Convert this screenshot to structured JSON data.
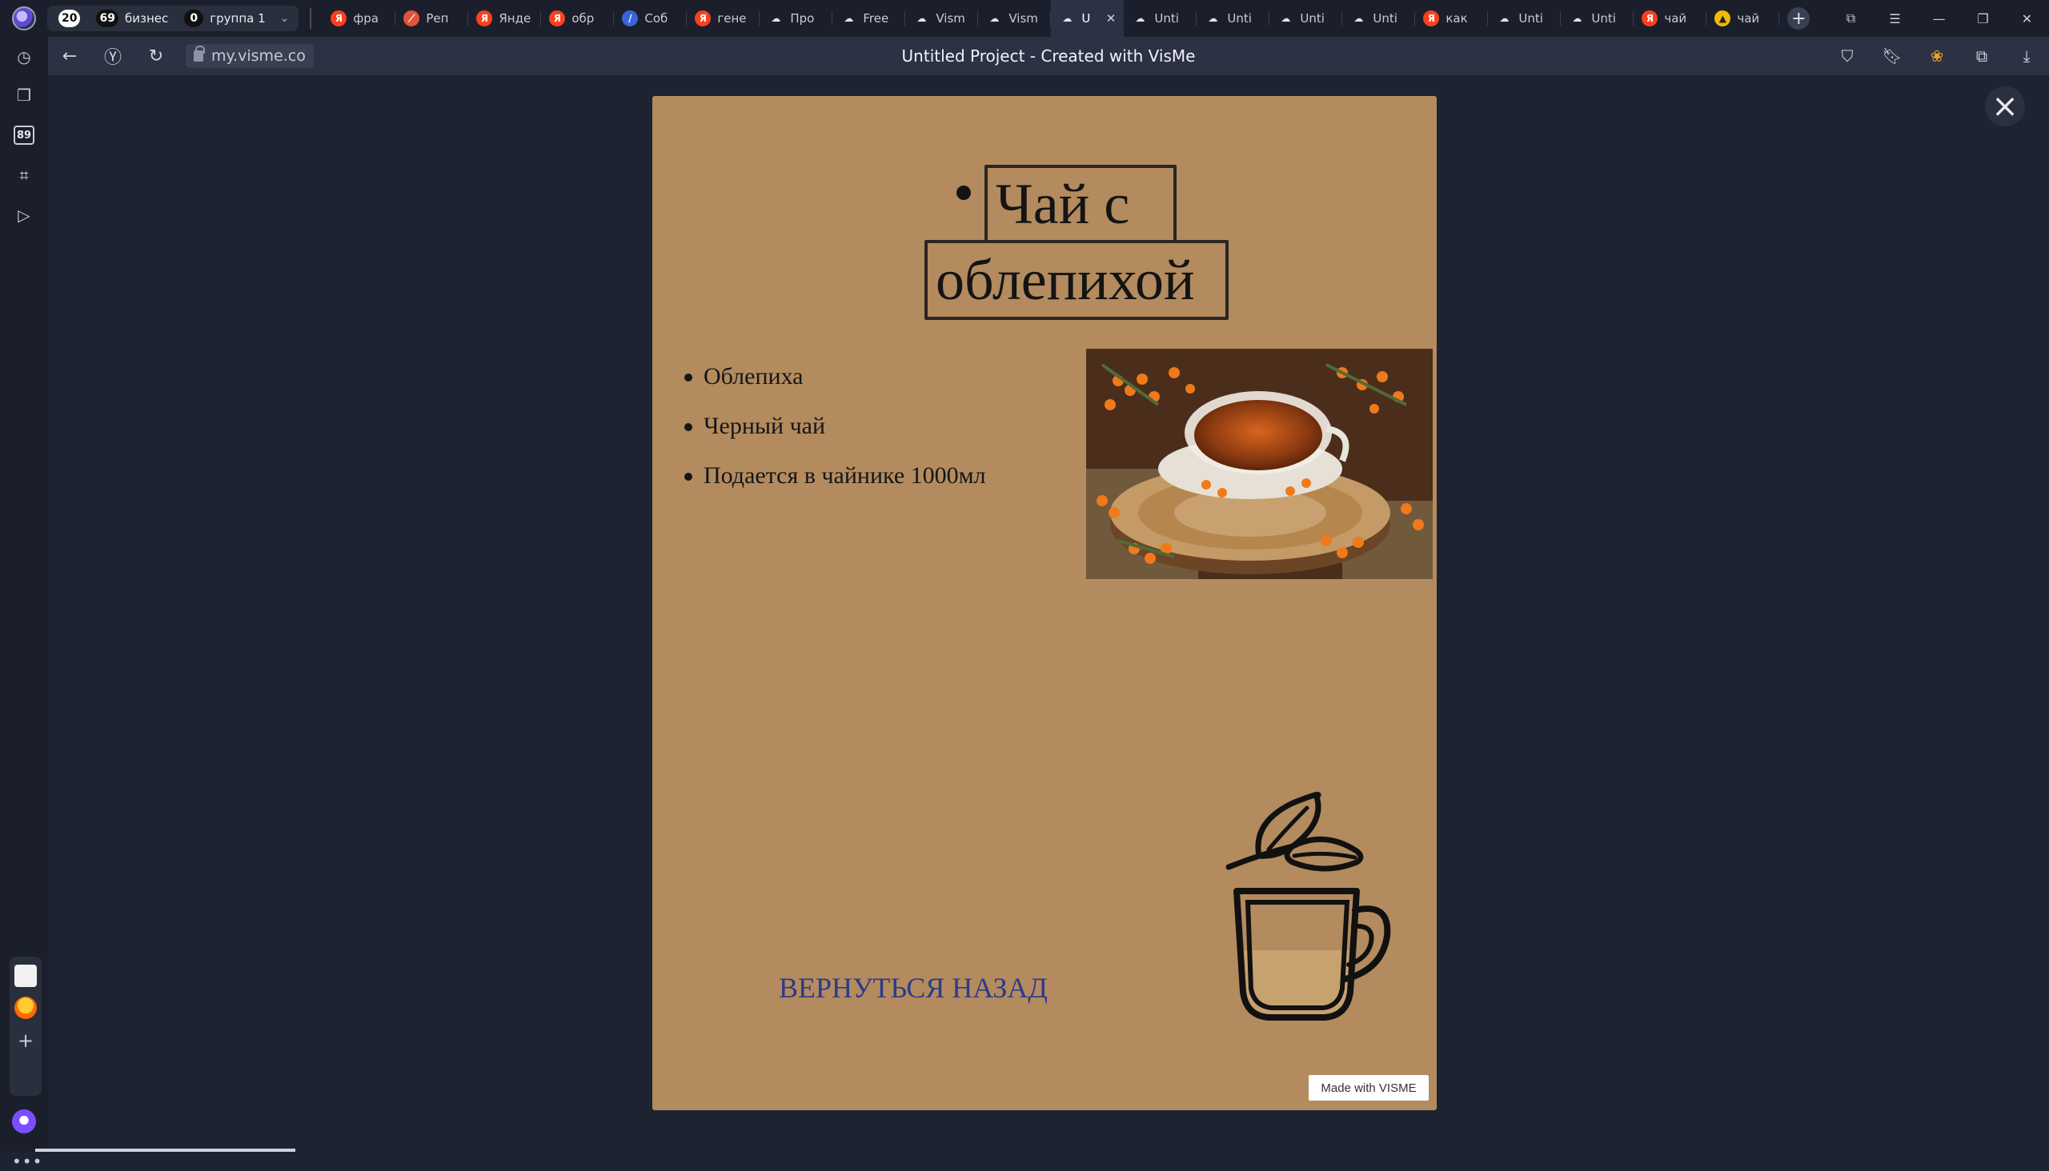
{
  "browser": {
    "tab_groups": [
      {
        "count": "20",
        "label": ""
      },
      {
        "count": "69",
        "label": "бизнес"
      },
      {
        "count": "0",
        "label": "группа 1"
      }
    ],
    "tabs": [
      {
        "title": "фра",
        "favicon": "yandex-icon"
      },
      {
        "title": "Реп",
        "favicon": "pdf-icon"
      },
      {
        "title": "Янде",
        "favicon": "yandex-icon"
      },
      {
        "title": "обр",
        "favicon": "yandex-icon"
      },
      {
        "title": "Соб",
        "favicon": "slash-icon"
      },
      {
        "title": "гене",
        "favicon": "yandex-icon"
      },
      {
        "title": "Про",
        "favicon": "visme-icon"
      },
      {
        "title": "Free",
        "favicon": "visme-icon"
      },
      {
        "title": "Vism",
        "favicon": "visme-icon"
      },
      {
        "title": "Vism",
        "favicon": "visme-icon"
      },
      {
        "title": "U",
        "favicon": "visme-icon",
        "active": true
      },
      {
        "title": "Unti",
        "favicon": "visme-icon"
      },
      {
        "title": "Unti",
        "favicon": "visme-icon"
      },
      {
        "title": "Unti",
        "favicon": "visme-icon"
      },
      {
        "title": "Unti",
        "favicon": "visme-icon"
      },
      {
        "title": "как",
        "favicon": "yandex-icon"
      },
      {
        "title": "Unti",
        "favicon": "visme-icon"
      },
      {
        "title": "Unti",
        "favicon": "visme-icon"
      },
      {
        "title": "чай",
        "favicon": "yandex-icon"
      },
      {
        "title": "чай",
        "favicon": "image-icon"
      }
    ],
    "url": "my.visme.co",
    "page_title": "Untitled Project - Created with VisMe",
    "sidebar_counter": "89"
  },
  "slide": {
    "title_line1": "Чай с",
    "title_line2": "облепихой",
    "features": [
      "Облепиха",
      "Черный чай",
      "Подается в чайнике 1000мл"
    ],
    "back_link": "ВЕРНУТЬСЯ НАЗАД",
    "made_with": "Made with VISME",
    "background_color": "#b38b5e",
    "link_color": "#2c3a8c"
  }
}
